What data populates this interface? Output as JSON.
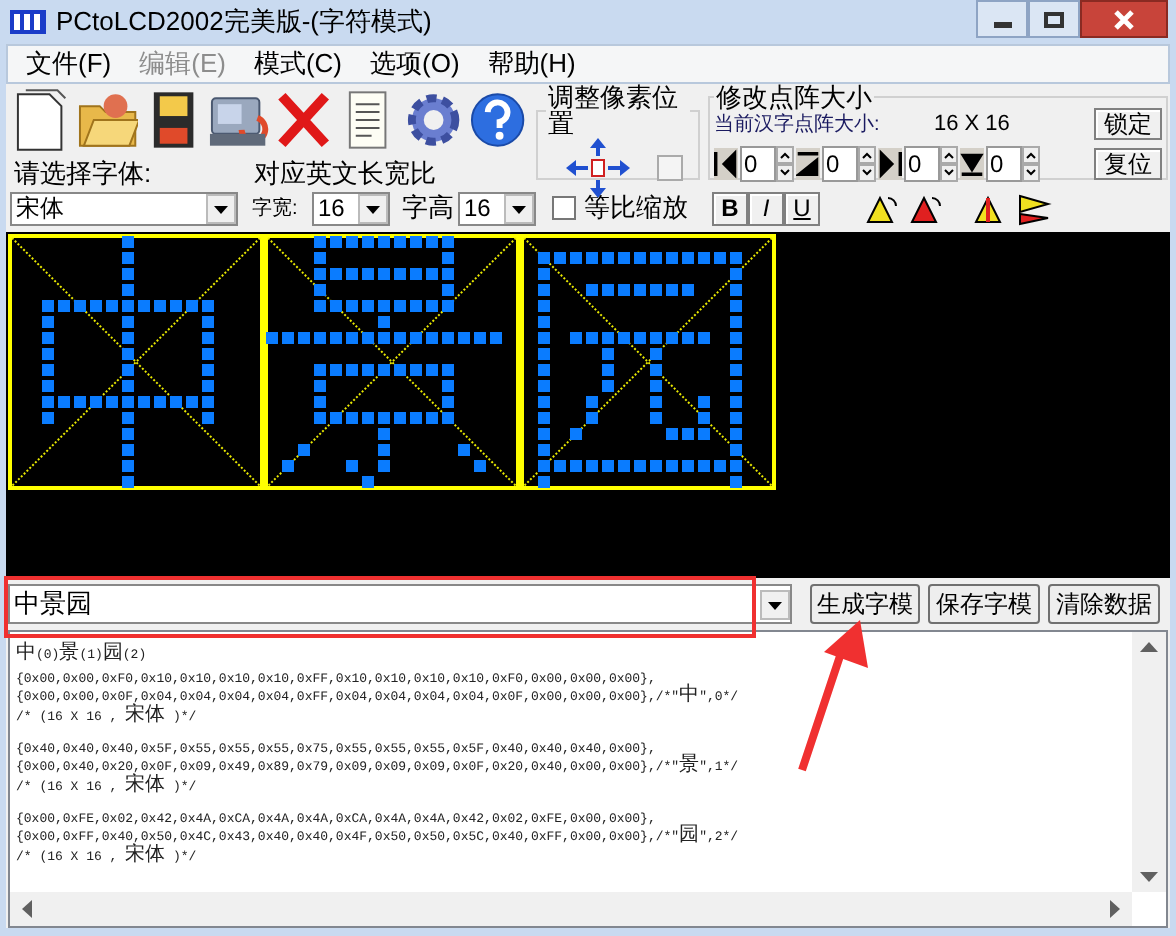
{
  "window": {
    "title": "PCtoLCD2002完美版-(字符模式)"
  },
  "menu": [
    {
      "label": "文件(F)",
      "disabled": false
    },
    {
      "label": "编辑(E)",
      "disabled": true
    },
    {
      "label": "模式(C)",
      "disabled": false
    },
    {
      "label": "选项(O)",
      "disabled": false
    },
    {
      "label": "帮助(H)",
      "disabled": false
    }
  ],
  "pixel_group": {
    "title": "调整像素位置"
  },
  "size_group": {
    "title": "修改点阵大小",
    "current_label": "当前汉字点阵大小:",
    "current_value": "16 X 16",
    "lock_button": "锁定",
    "reset_button": "复位",
    "spinners": [
      {
        "kind": "left",
        "value": "0"
      },
      {
        "kind": "top",
        "value": "0"
      },
      {
        "kind": "right",
        "value": "0"
      },
      {
        "kind": "bottom",
        "value": "0"
      }
    ]
  },
  "font_label": "请选择字体:",
  "ratio_label": "对应英文长宽比",
  "font": {
    "value": "宋体"
  },
  "width_label": "字宽:",
  "width_value": "16",
  "height_label": "字高",
  "height_value": "16",
  "proportional": {
    "label": "等比缩放",
    "checked": false
  },
  "style_buttons": [
    "B",
    "I",
    "U"
  ],
  "input": {
    "value": "中景园"
  },
  "buttons": [
    "生成字模",
    "保存字模",
    "清除数据"
  ],
  "output": {
    "header": "中(0)景(1)园(2)",
    "blocks": [
      {
        "lines": [
          "{0x00,0x00,0xF0,0x10,0x10,0x10,0x10,0xFF,0x10,0x10,0x10,0x10,0xF0,0x00,0x00,0x00},",
          "{0x00,0x00,0x0F,0x04,0x04,0x04,0x04,0xFF,0x04,0x04,0x04,0x04,0x0F,0x00,0x00,0x00},/*\"中\",0*/",
          "/* (16 X 16 , 宋体 )*/"
        ]
      },
      {
        "lines": [
          "{0x40,0x40,0x40,0x5F,0x55,0x55,0x55,0x75,0x55,0x55,0x55,0x5F,0x40,0x40,0x40,0x00},",
          "{0x00,0x40,0x20,0x0F,0x09,0x49,0x89,0x79,0x09,0x09,0x09,0x0F,0x20,0x40,0x00,0x00},/*\"景\",1*/",
          "/* (16 X 16 , 宋体 )*/"
        ]
      },
      {
        "lines": [
          "{0x00,0xFE,0x02,0x42,0x4A,0xCA,0x4A,0x4A,0xCA,0x4A,0x4A,0x42,0x02,0xFE,0x00,0x00},",
          "{0x00,0xFF,0x40,0x50,0x4C,0x43,0x40,0x40,0x4F,0x50,0x50,0x5C,0x40,0xFF,0x00,0x00},/*\"园\",2*/",
          "/* (16 X 16 , 宋体 )*/"
        ]
      }
    ]
  },
  "annotations": [
    {
      "kind": "box"
    },
    {
      "kind": "arrow"
    }
  ]
}
